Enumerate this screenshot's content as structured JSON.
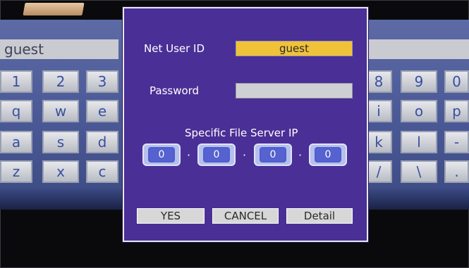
{
  "keyboard": {
    "input_value": "guest",
    "keys": [
      "1",
      "2",
      "3",
      "8",
      "9",
      "0",
      "q",
      "w",
      "e",
      "i",
      "o",
      "p",
      "a",
      "s",
      "d",
      "k",
      "l",
      "-",
      "z",
      "x",
      "c",
      "/",
      "\\",
      "."
    ]
  },
  "dialog": {
    "net_user_id_label": "Net User ID",
    "net_user_id_value": "guest",
    "password_label": "Password",
    "password_value": "",
    "ip_label": "Specific File Server IP",
    "ip_octets": [
      "0",
      "0",
      "0",
      "0"
    ],
    "ip_separator": "·",
    "buttons": {
      "yes": "YES",
      "cancel": "CANCEL",
      "detail": "Detail"
    }
  },
  "colors": {
    "dialog_bg": "#4a2f96",
    "highlight": "#f0c23a",
    "keyboard_bg": "#4b5a97"
  }
}
